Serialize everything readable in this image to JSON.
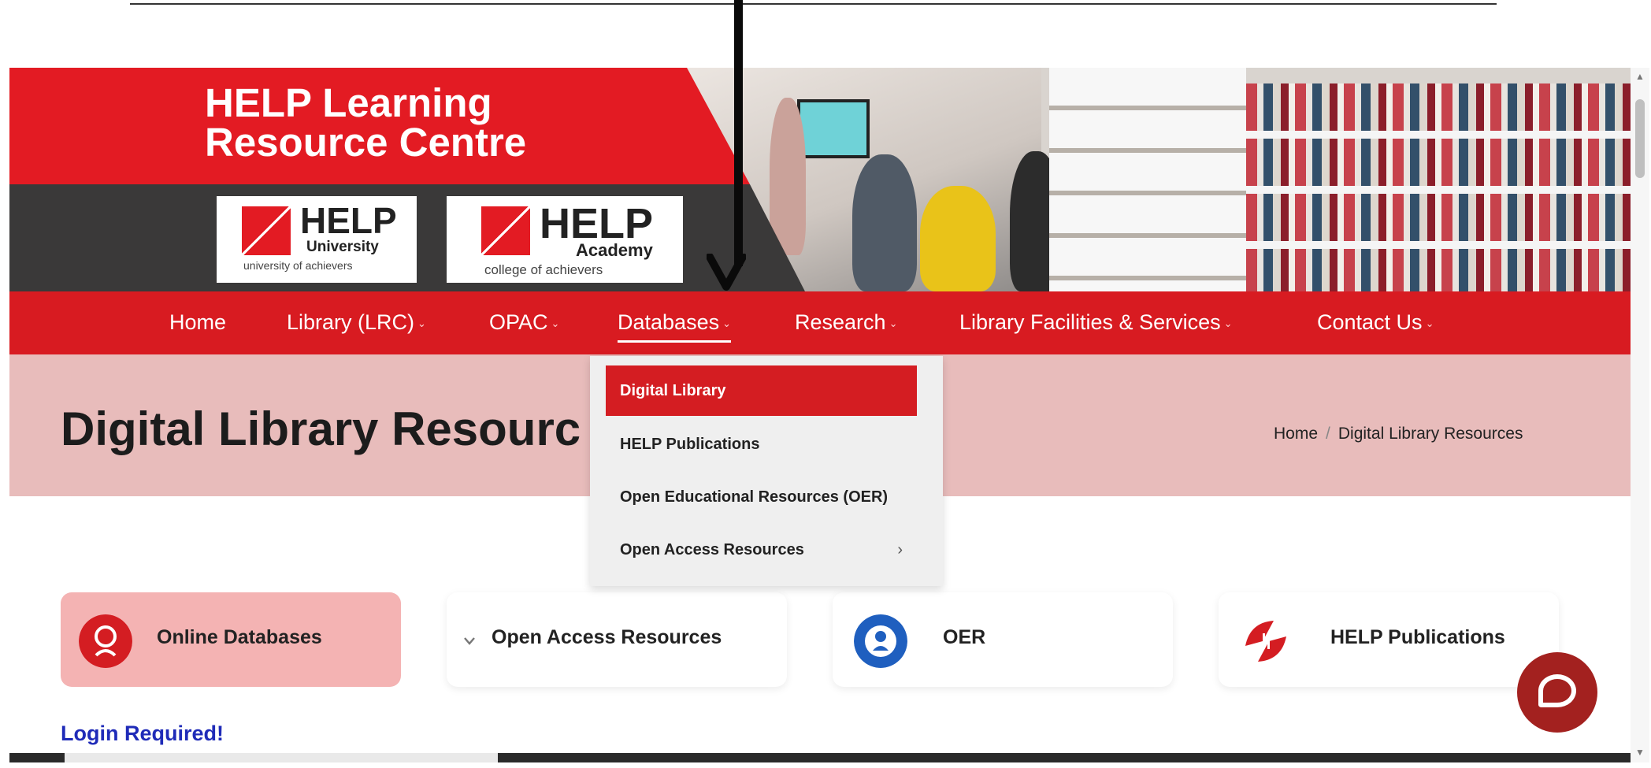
{
  "banner": {
    "title_line1": "HELP Learning",
    "title_line2": "Resource Centre",
    "logo_university": {
      "name": "HELP",
      "sub": "University",
      "tagline": "university of achievers"
    },
    "logo_academy": {
      "name": "HELP",
      "sub": "Academy",
      "tagline": "college of achievers"
    }
  },
  "nav": {
    "items": [
      {
        "label": "Home",
        "has_caret": false
      },
      {
        "label": "Library (LRC)",
        "has_caret": true
      },
      {
        "label": "OPAC",
        "has_caret": true
      },
      {
        "label": "Databases",
        "has_caret": true,
        "active": true
      },
      {
        "label": "Research",
        "has_caret": true
      },
      {
        "label": "Library Facilities & Services",
        "has_caret": true
      },
      {
        "label": "Contact Us",
        "has_caret": true
      }
    ],
    "caret": "⌄"
  },
  "dropdown": {
    "items": [
      {
        "label": "Digital Library",
        "selected": true
      },
      {
        "label": "HELP Publications"
      },
      {
        "label": "Open Educational Resources (OER)"
      },
      {
        "label": "Open Access Resources",
        "has_submenu": true
      }
    ],
    "submenu_chevron": "›"
  },
  "page": {
    "title": "Digital Library Resourc",
    "breadcrumb": {
      "home": "Home",
      "separator": "/",
      "current": "Digital Library Resources"
    }
  },
  "cards": [
    {
      "label": "Online Databases",
      "icon": "online-databases-icon"
    },
    {
      "label": "Open Access Resources",
      "icon": "open-access-icon"
    },
    {
      "label": "OER",
      "icon": "oer-icon"
    },
    {
      "label": "HELP Publications",
      "icon": "help-publications-icon"
    }
  ],
  "notice": {
    "login_required": "Login Required!"
  },
  "colors": {
    "brand_red": "#d81b21",
    "band_pink": "#e8bcbb",
    "card_pink": "#f4b3b3",
    "login_blue": "#1f2bb8",
    "chat": "#a3211f"
  }
}
